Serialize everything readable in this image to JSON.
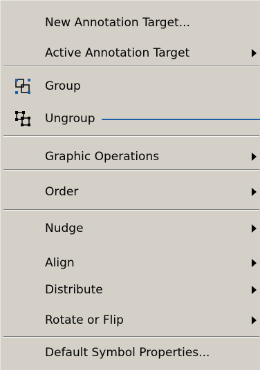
{
  "menu": {
    "items": {
      "new_annotation_target": {
        "label": "New Annotation Target..."
      },
      "active_annotation_target": {
        "label": "Active Annotation Target",
        "submenu": true
      },
      "group": {
        "label": "Group",
        "icon": "group-icon"
      },
      "ungroup": {
        "label": "Ungroup",
        "icon": "ungroup-icon"
      },
      "graphic_operations": {
        "label": "Graphic Operations",
        "submenu": true
      },
      "order": {
        "label": "Order",
        "submenu": true
      },
      "nudge": {
        "label": "Nudge",
        "submenu": true
      },
      "align": {
        "label": "Align",
        "submenu": true
      },
      "distribute": {
        "label": "Distribute",
        "submenu": true
      },
      "rotate_or_flip": {
        "label": "Rotate or Flip",
        "submenu": true
      },
      "default_symbol_properties": {
        "label": "Default Symbol Properties..."
      }
    }
  },
  "colors": {
    "menu_background": "#d4d0c8",
    "callout_line": "#1f5fa8",
    "icon_accent": "#1f5fa8"
  }
}
